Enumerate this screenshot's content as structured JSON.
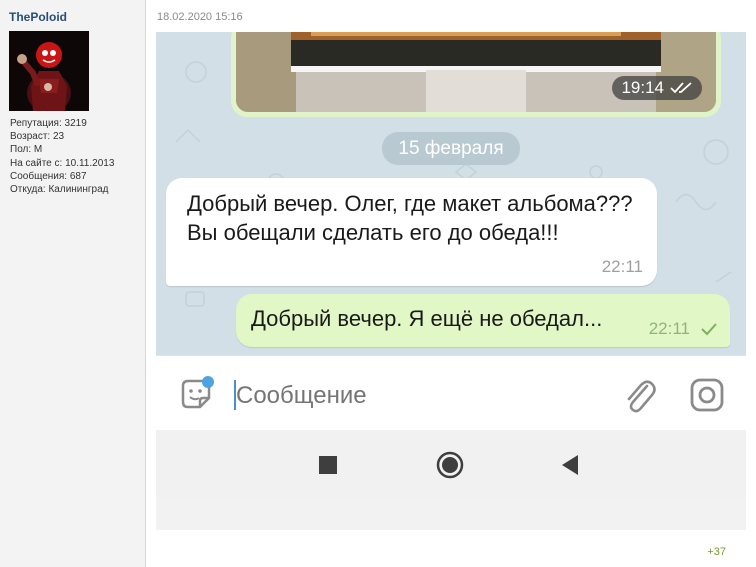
{
  "user": {
    "name": "ThePoloid",
    "stats": [
      "Репутация: 3219",
      "Возраст: 23",
      "Пол: М",
      "На сайте с: 10.11.2013",
      "Сообщения: 687",
      "Откуда: Калининград"
    ]
  },
  "post": {
    "date": "18.02.2020 15:16",
    "reaction": "+37"
  },
  "chat": {
    "photo_time": "19:14",
    "date_separator": "15 февраля",
    "incoming": {
      "text": "Добрый вечер. Олег, где макет альбома??? Вы обещали сделать его до обеда!!!",
      "time": "22:11"
    },
    "outgoing": {
      "text": "Добрый вечер. Я ещё не обедал...",
      "time": "22:11"
    },
    "input": {
      "placeholder": "Сообщение"
    },
    "icons": {
      "sticker": "sticker-icon",
      "attach": "paperclip-icon",
      "camera": "camera-icon",
      "read": "double-check-icon",
      "sent": "check-icon"
    }
  },
  "colors": {
    "username": "#274f74",
    "chat_background": "#d3dfe6",
    "outgoing_bubble": "#e1f7c6",
    "reaction": "#7a9a2e"
  }
}
